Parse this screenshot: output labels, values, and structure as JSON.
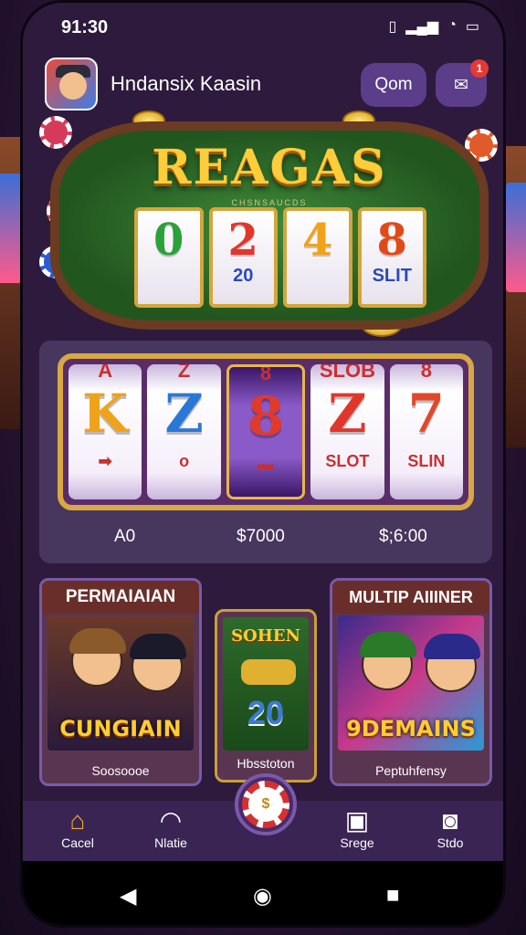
{
  "status": {
    "time": "9​1:30",
    "icons": [
      "vibrate-icon",
      "signal-icon",
      "wifi-icon",
      "battery-icon"
    ]
  },
  "header": {
    "title": "Hndansix Kaasin",
    "search_label": "Qom",
    "notification_count": "1"
  },
  "hero": {
    "title": "REAGAS",
    "subtitle": "CHSNSAUCDS",
    "reels": [
      {
        "big": "0",
        "small": "",
        "color": "#2aa13a"
      },
      {
        "big": "2",
        "small": "20",
        "color": "#e0372c"
      },
      {
        "big": "4",
        "small": "",
        "color": "#f0a21a"
      },
      {
        "big": "8",
        "small": "SLIT",
        "color": "#e04a18"
      }
    ]
  },
  "slots": {
    "reels": [
      {
        "top": "A",
        "mid": "K",
        "bot": "➡",
        "color": "#f0a21a"
      },
      {
        "top": "Z",
        "mid": "Z",
        "bot": "o",
        "color": "#2a78d6"
      },
      {
        "top": "8",
        "mid": "8",
        "bot": "▬",
        "color": "#e03a2c"
      },
      {
        "top": "SLOB",
        "mid": "Z",
        "bot": "SLOT",
        "color": "#e0372c"
      },
      {
        "top": "8",
        "mid": "7",
        "bot": "SLIN",
        "color": "#e0482c"
      }
    ],
    "payouts": [
      "A0",
      "$7000",
      "$;6:00"
    ]
  },
  "cards": {
    "left": {
      "title": "PERMAIAIAN",
      "art_text": "CUNGIAIN",
      "footer": "Soosoooe"
    },
    "middle": {
      "title": "SOHEN",
      "value": "20",
      "footer": "Hbsstoton"
    },
    "right": {
      "title": "MULTIP AIIINER",
      "art_text": "9DEMAINS",
      "footer": "Peptuhfensy"
    }
  },
  "nav": {
    "items": [
      {
        "label": "Cacel",
        "icon": "home-icon"
      },
      {
        "label": "Nlatie",
        "icon": "gauge-icon"
      },
      {
        "label": "Srege",
        "icon": "bag-icon"
      },
      {
        "label": "Stdo",
        "icon": "camera-icon"
      }
    ],
    "fab_label": "$"
  }
}
